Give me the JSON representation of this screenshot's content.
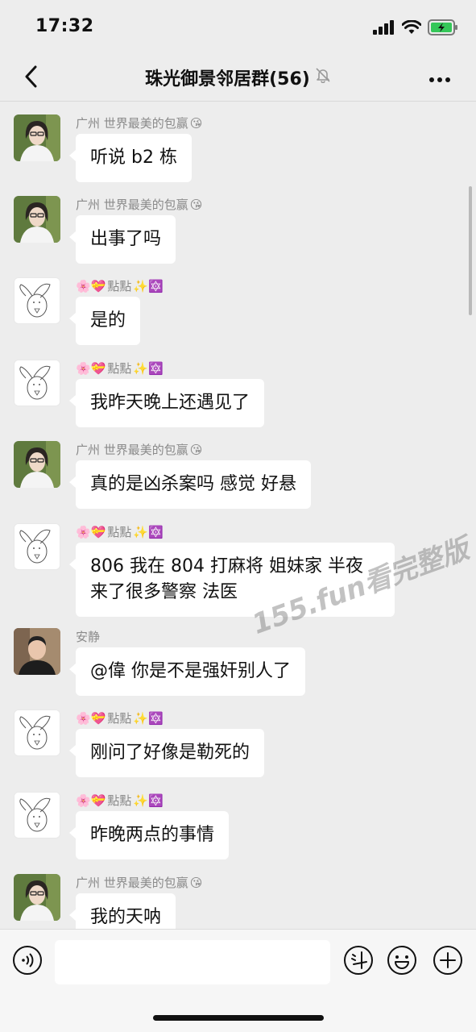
{
  "status": {
    "time": "17:32"
  },
  "header": {
    "title": "珠光御景邻居群(56)"
  },
  "icons": {
    "back": "chevron-left-icon",
    "mute": "bell-slash-icon",
    "more": "more-dots-icon",
    "voice": "voice-icon",
    "douyin": "dou-icon",
    "emoji": "emoji-icon",
    "add": "plus-circle-icon"
  },
  "messages": [
    {
      "sender": "广州 世界最美的包赢",
      "sender_emoji": "😘",
      "avatar": "girl",
      "text": "听说 b2 栋"
    },
    {
      "sender": "广州 世界最美的包赢",
      "sender_emoji": "😘",
      "avatar": "girl",
      "text": "出事了吗"
    },
    {
      "sender_prefix": "🌸💝",
      "sender": "點點",
      "sender_emoji": "✨🔯",
      "avatar": "bunny",
      "text": "是的"
    },
    {
      "sender_prefix": "🌸💝",
      "sender": "點點",
      "sender_emoji": "✨🔯",
      "avatar": "bunny",
      "text": "我昨天晚上还遇见了"
    },
    {
      "sender": "广州 世界最美的包赢",
      "sender_emoji": "😘",
      "avatar": "girl",
      "text": "真的是凶杀案吗 感觉 好悬"
    },
    {
      "sender_prefix": "🌸💝",
      "sender": "點點",
      "sender_emoji": "✨🔯",
      "avatar": "bunny",
      "text": "806 我在 804 打麻将 姐妹家 半夜来了很多警察 法医"
    },
    {
      "sender": "安静",
      "sender_emoji": "",
      "avatar": "man",
      "text": "@偉 你是不是强奸别人了"
    },
    {
      "sender_prefix": "🌸💝",
      "sender": "點點",
      "sender_emoji": "✨🔯",
      "avatar": "bunny",
      "text": "刚问了好像是勒死的"
    },
    {
      "sender_prefix": "🌸💝",
      "sender": "點點",
      "sender_emoji": "✨🔯",
      "avatar": "bunny",
      "text": "昨晚两点的事情"
    },
    {
      "sender": "广州 世界最美的包赢",
      "sender_emoji": "😘",
      "avatar": "girl",
      "text": "我的天呐"
    }
  ],
  "watermark": "155.fun看完整版"
}
